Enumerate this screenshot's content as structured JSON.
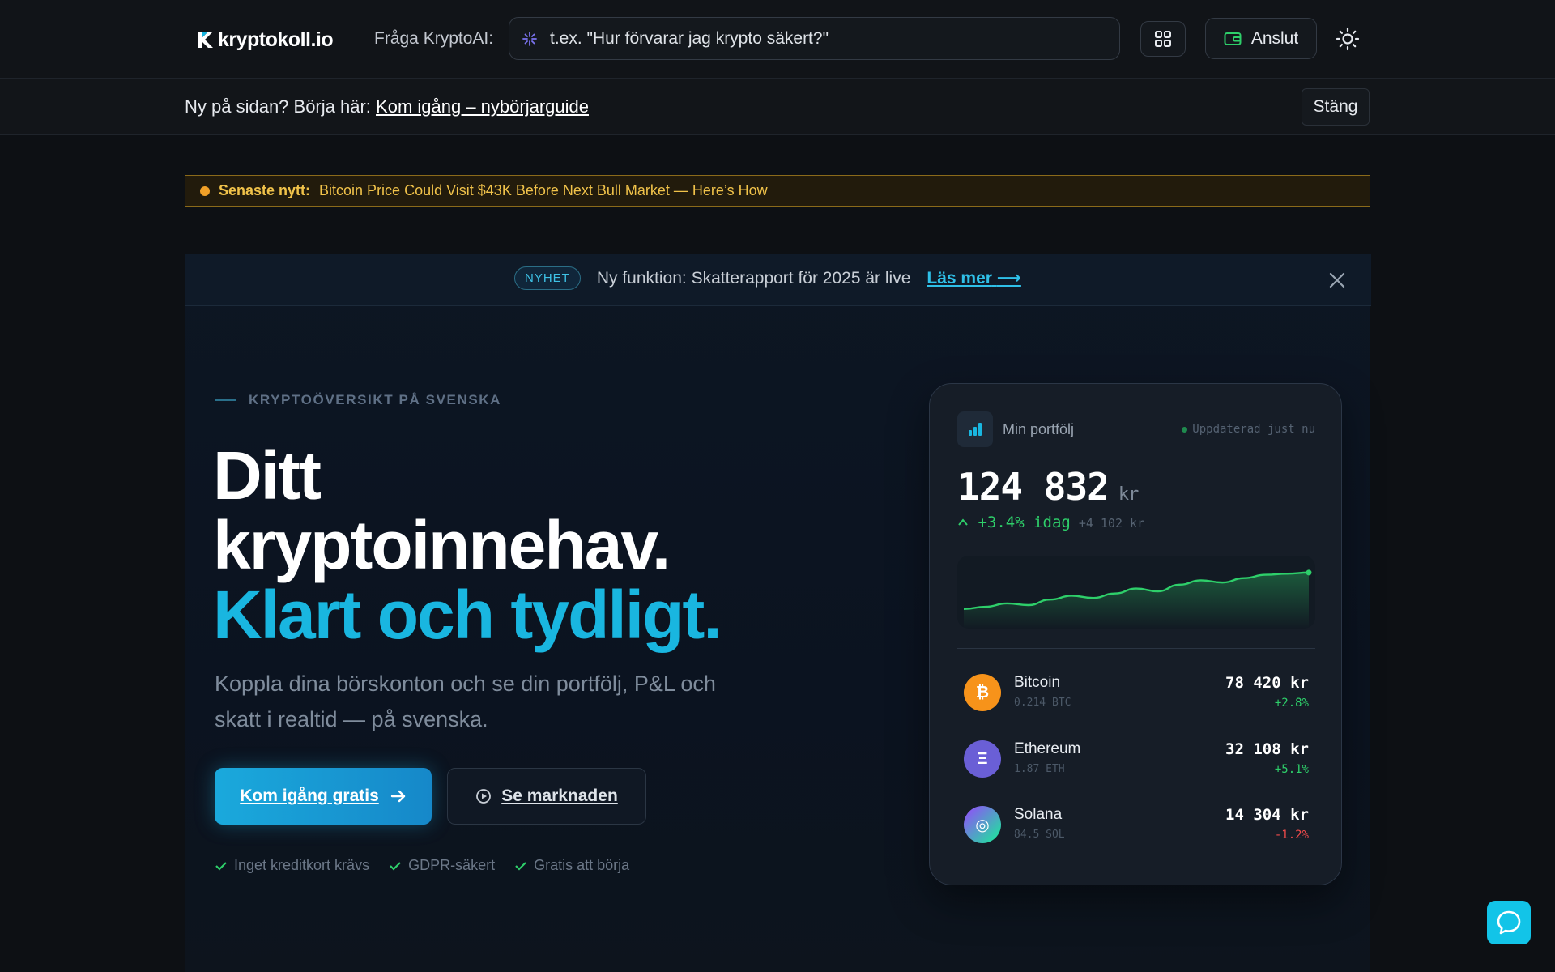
{
  "header": {
    "logo_text": "kryptokoll.io",
    "ask_label": "Fråga KryptoAI:",
    "search_placeholder": "t.ex. \"Hur förvarar jag krypto säkert?\"",
    "connect_label": "Anslut",
    "icons": [
      "grid-icon",
      "wallet-icon",
      "sun-icon",
      "sparkle-icon"
    ]
  },
  "onboarding": {
    "prefix": "Ny på sidan? Börja här:",
    "link": "Kom igång – nybörjarguide",
    "close_label": "Stäng"
  },
  "ticker": {
    "label": "Senaste nytt:",
    "headline": "Bitcoin Price Could Visit $43K Before Next Bull Market — Here’s How"
  },
  "announcement": {
    "badge": "NYHET",
    "text": "Ny funktion: Skatterapport för 2025 är live",
    "link": "Läs mer"
  },
  "hero": {
    "eyebrow": "KRYPTOÖVERSIKT PÅ SVENSKA",
    "headline_line1": "Ditt",
    "headline_line2": "kryptoinnehav.",
    "headline_accent": "Klart och tydligt.",
    "subtitle": "Koppla dina börskonton och se din portfölj, P&L och skatt i realtid — på svenska.",
    "cta_primary": "Kom igång gratis",
    "cta_secondary": "Se marknaden",
    "checks": [
      "Inget kreditkort krävs",
      "GDPR-säkert",
      "Gratis att börja"
    ]
  },
  "portfolio": {
    "title": "Min portfölj",
    "updated": "Uppdaterad just nu",
    "total_value": "124 832",
    "currency": "kr",
    "change_today": "+3.4% idag",
    "change_abs": "+4 102 kr",
    "sparkline": [
      0.18,
      0.22,
      0.28,
      0.25,
      0.35,
      0.42,
      0.38,
      0.46,
      0.55,
      0.5,
      0.62,
      0.7,
      0.66,
      0.74,
      0.8,
      0.82,
      0.84
    ],
    "assets": [
      {
        "name": "Bitcoin",
        "amount": "0.214 BTC",
        "value": "78 420 kr",
        "change": "+2.8%",
        "direction": "up",
        "color": "#f7931a",
        "symbol": "₿"
      },
      {
        "name": "Ethereum",
        "amount": "1.87 ETH",
        "value": "32 108 kr",
        "change": "+5.1%",
        "direction": "up",
        "color": "#6a5fd6",
        "symbol": "Ξ"
      },
      {
        "name": "Solana",
        "amount": "84.5 SOL",
        "value": "14 304 kr",
        "change": "-1.2%",
        "direction": "down",
        "color": "#3bc7c4",
        "symbol": "◎"
      }
    ]
  },
  "colors": {
    "accent": "#19b6e0",
    "positive": "#2ecf6a",
    "negative": "#ef4b4b",
    "ticker": "#f0c24a"
  }
}
